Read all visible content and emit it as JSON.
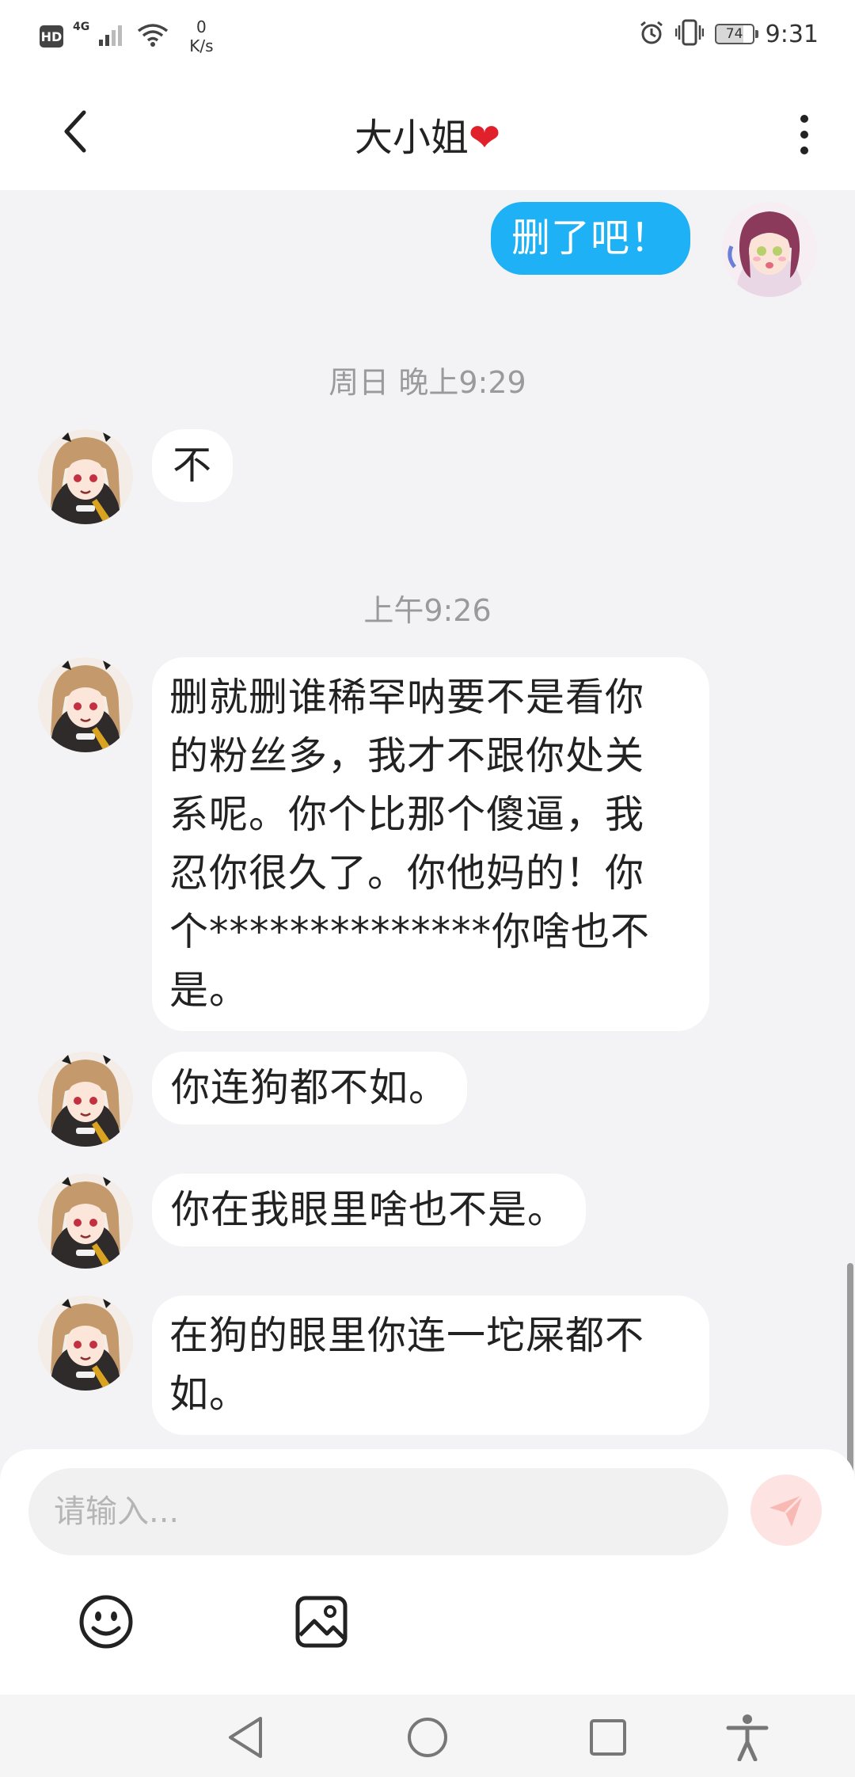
{
  "status_bar": {
    "hd": "HD",
    "network": "4G",
    "speed_value": "0",
    "speed_unit": "K/s",
    "battery": "74",
    "time": "9:31"
  },
  "header": {
    "title": "大小姐",
    "title_emoji": "❤"
  },
  "messages": [
    {
      "side": "mine",
      "text": "删了吧！"
    },
    {
      "type": "timestamp",
      "text": "周日 晚上9:29"
    },
    {
      "side": "theirs",
      "text": "不"
    },
    {
      "type": "timestamp",
      "text": "上午9:26"
    },
    {
      "side": "theirs",
      "lines": [
        "删就删谁稀罕呐要不是看你",
        "的粉丝多，我才不跟你处关",
        "系呢。你个比那个傻逼，我",
        "忍你很久了。你他妈的！你",
        "个**************你啥也不",
        "是。"
      ]
    },
    {
      "side": "theirs",
      "text": "你连狗都不如。"
    },
    {
      "side": "theirs",
      "text": "你在我眼里啥也不是。"
    },
    {
      "side": "theirs",
      "lines": [
        "在狗的眼里你连一坨屎都不",
        "如。"
      ]
    }
  ],
  "input": {
    "placeholder": "请输入..."
  },
  "icons": {
    "back": "chevron-left-icon",
    "more": "more-vertical-icon",
    "send": "send-icon",
    "emoji": "emoji-icon",
    "image": "image-icon",
    "nav_back": "nav-back-icon",
    "nav_home": "nav-home-icon",
    "nav_recents": "nav-recents-icon",
    "accessibility": "accessibility-icon"
  },
  "colors": {
    "my_bubble": "#1fb1f5",
    "their_bubble": "#ffffff",
    "background": "#f3f3f5",
    "send_button": "#fde3e1"
  }
}
